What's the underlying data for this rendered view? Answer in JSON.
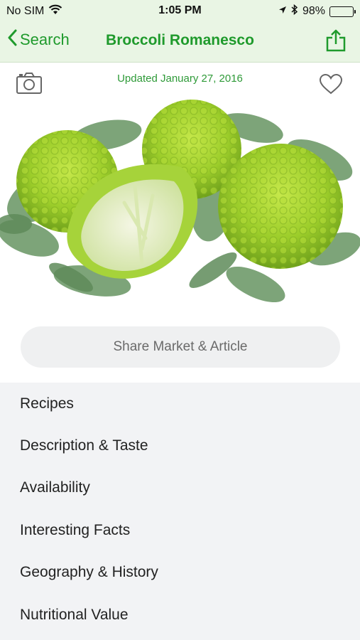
{
  "status_bar": {
    "carrier": "No SIM",
    "time": "1:05 PM",
    "battery_percent": "98%",
    "battery_level": 0.98,
    "icons": [
      "wifi-icon",
      "location-arrow-icon",
      "bluetooth-icon",
      "battery-icon"
    ]
  },
  "navbar": {
    "back_label": "Search",
    "title": "Broccoli Romanesco",
    "accent_color": "#1f9a2c"
  },
  "header": {
    "updated_text": "Updated January 27, 2016"
  },
  "hero": {
    "icon": "romanesco-broccoli-photo"
  },
  "share_button": {
    "label": "Share Market & Article"
  },
  "menu": {
    "items": [
      {
        "label": "Recipes"
      },
      {
        "label": "Description & Taste"
      },
      {
        "label": "Availability"
      },
      {
        "label": "Interesting Facts"
      },
      {
        "label": "Geography & History"
      },
      {
        "label": "Nutritional Value"
      }
    ]
  }
}
